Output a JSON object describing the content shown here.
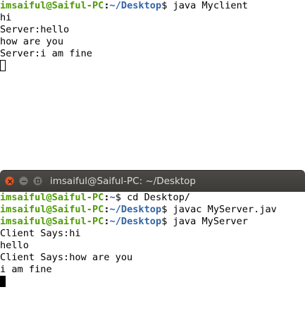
{
  "top_terminal": {
    "lines": [
      {
        "user": "imsaiful@Saiful-PC",
        "sep": ":",
        "path": "~/Desktop",
        "cmd": "$ java Myclient"
      },
      {
        "text": "hi"
      },
      {
        "text": "Server:hello"
      },
      {
        "text": "how are you"
      },
      {
        "text": "Server:i am fine"
      }
    ]
  },
  "bottom_window": {
    "title": "imsaiful@Saiful-PC: ~/Desktop"
  },
  "bottom_terminal": {
    "lines": [
      {
        "user": "imsaiful@Saiful-PC",
        "sep": ":",
        "path": "~",
        "cmd": "$ cd Desktop/"
      },
      {
        "user": "imsaiful@Saiful-PC",
        "sep": ":",
        "path": "~/Desktop",
        "cmd": "$ javac MyServer.jav"
      },
      {
        "user": "imsaiful@Saiful-PC",
        "sep": ":",
        "path": "~/Desktop",
        "cmd": "$ java MyServer"
      },
      {
        "text": "Client Says:hi"
      },
      {
        "text": "hello"
      },
      {
        "text": "Client Says:how are you"
      },
      {
        "text": "i am fine"
      }
    ]
  }
}
